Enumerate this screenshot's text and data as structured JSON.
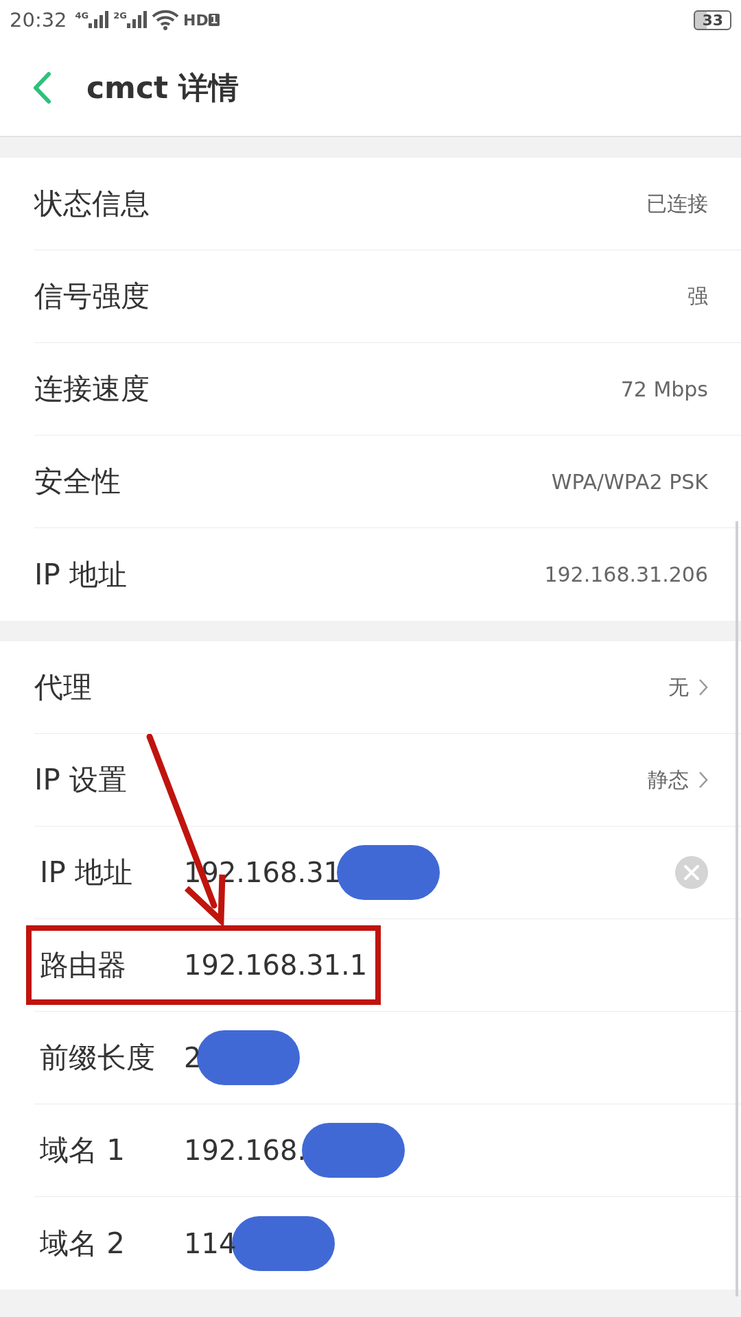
{
  "status_bar": {
    "time": "20:32",
    "sim1": "4G",
    "sim2": "2G",
    "hd": "HD",
    "hd_slot": "1",
    "battery": "33"
  },
  "header": {
    "title": "cmct 详情"
  },
  "info_rows": [
    {
      "label": "状态信息",
      "value": "已连接"
    },
    {
      "label": "信号强度",
      "value": "强"
    },
    {
      "label": "连接速度",
      "value": "72 Mbps"
    },
    {
      "label": "安全性",
      "value": "WPA/WPA2 PSK"
    },
    {
      "label": "IP 地址",
      "value": "192.168.31.206"
    }
  ],
  "settings_rows": [
    {
      "kind": "link",
      "label": "代理",
      "value": "无"
    },
    {
      "kind": "link",
      "label": "IP 设置",
      "value": "静态"
    },
    {
      "kind": "field",
      "label": "IP 地址",
      "value": "192.168.31",
      "clearable": true,
      "redacted": true,
      "highlighted": false
    },
    {
      "kind": "field",
      "label": "路由器",
      "value": "192.168.31.1",
      "clearable": false,
      "redacted": false,
      "highlighted": true
    },
    {
      "kind": "field",
      "label": "前缀长度",
      "value": "2",
      "clearable": false,
      "redacted": true,
      "highlighted": false
    },
    {
      "kind": "field",
      "label": "域名 1",
      "value": "192.168.",
      "clearable": false,
      "redacted": true,
      "highlighted": false
    },
    {
      "kind": "field",
      "label": "域名 2",
      "value": "114",
      "clearable": false,
      "redacted": true,
      "highlighted": false
    }
  ]
}
